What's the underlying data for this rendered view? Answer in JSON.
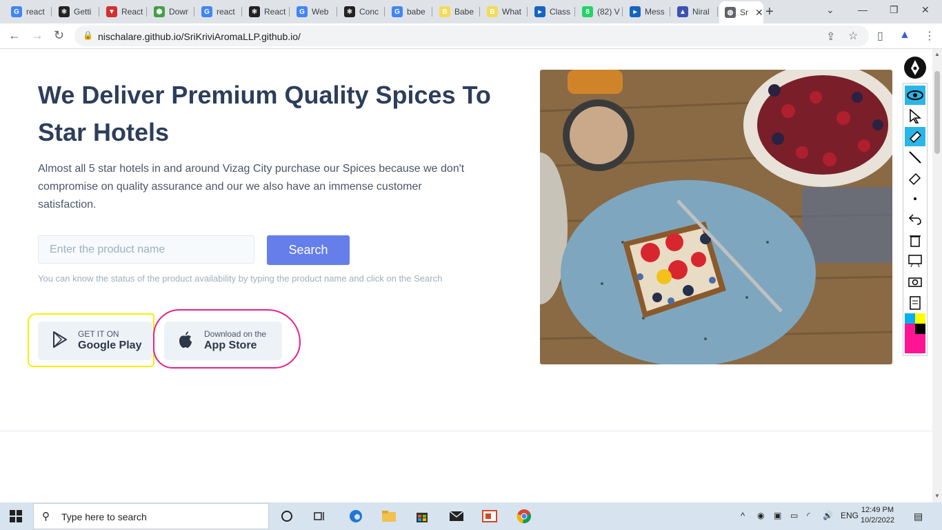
{
  "browser": {
    "tabs": [
      {
        "label": "react",
        "icon": "google-icon"
      },
      {
        "label": "Getti",
        "icon": "react-icon"
      },
      {
        "label": "React",
        "icon": "vercel-icon"
      },
      {
        "label": "Dowr",
        "icon": "node-icon"
      },
      {
        "label": "react",
        "icon": "google-icon"
      },
      {
        "label": "React",
        "icon": "react-icon"
      },
      {
        "label": "Web",
        "icon": "google-icon"
      },
      {
        "label": "Conc",
        "icon": "react-icon"
      },
      {
        "label": "babe",
        "icon": "google-icon"
      },
      {
        "label": "Babe",
        "icon": "babel-icon"
      },
      {
        "label": "What",
        "icon": "babel-icon"
      },
      {
        "label": "Class",
        "icon": "course-icon"
      },
      {
        "label": "(82) V",
        "icon": "whatsapp-icon"
      },
      {
        "label": "Mess",
        "icon": "course-icon"
      },
      {
        "label": "Niral",
        "icon": "niral-icon"
      },
      {
        "label": "Sr",
        "icon": "globe-icon",
        "active": true
      }
    ],
    "url": "nischalare.github.io/SriKriviAromaLLP.github.io/"
  },
  "hero": {
    "title": "We Deliver Premium Quality Spices To Star Hotels",
    "description": "Almost all 5 star hotels in and around Vizag City purchase our Spices because we don't compromise on quality assurance and our we also have an immense customer satisfaction.",
    "search_placeholder": "Enter the product name",
    "search_button": "Search",
    "helper_text": "You can know the status of the product availability by typing the product name and click on the Search",
    "google_play": {
      "small": "GET IT ON",
      "big": "Google Play"
    },
    "app_store": {
      "small": "Download on the",
      "big": "App Store"
    }
  },
  "taskbar": {
    "search_text": "Type here to search",
    "language": "ENG",
    "time": "12:49 PM",
    "date": "10/2/2022"
  },
  "colors": {
    "accent": "#667eea",
    "title": "#2d3e5b",
    "annotation_yellow": "#f5f000",
    "annotation_pink": "#e91e8c"
  }
}
